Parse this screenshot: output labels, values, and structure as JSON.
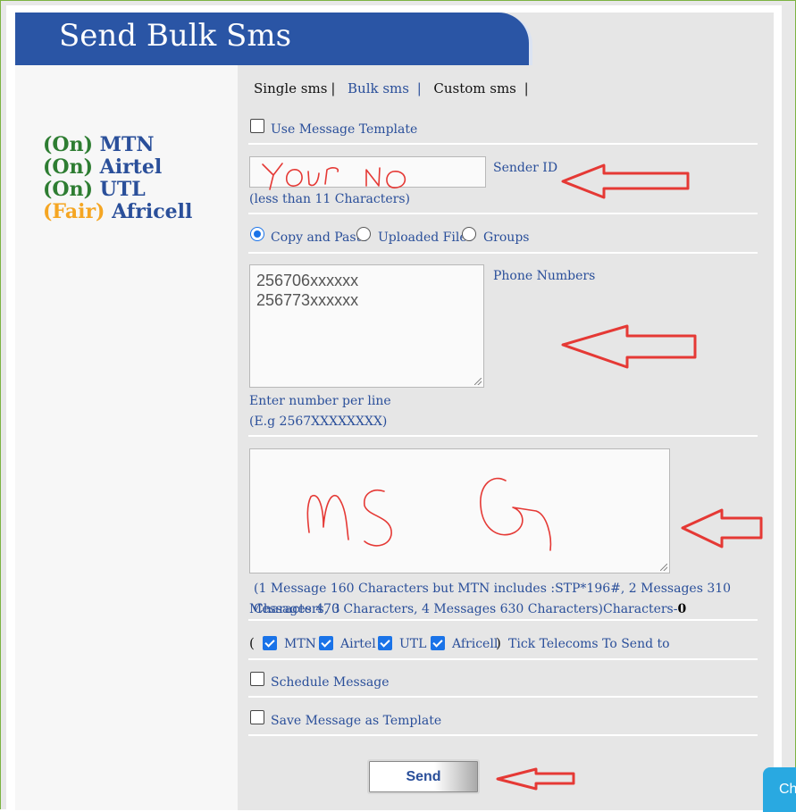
{
  "header": {
    "title": "Send Bulk Sms"
  },
  "status": [
    {
      "state": "(On)",
      "network": "MTN",
      "color": "#2e7d32"
    },
    {
      "state": "(On)",
      "network": "Airtel",
      "color": "#2e7d32"
    },
    {
      "state": "(On)",
      "network": "UTL",
      "color": "#2e7d32"
    },
    {
      "state": "(Fair)",
      "network": "Africell",
      "color": "#f5a623"
    }
  ],
  "tabs": {
    "single": "Single sms",
    "sep1": "|",
    "bulk": "Bulk sms",
    "sep2": "|",
    "custom": "Custom sms",
    "sep3": "|"
  },
  "form": {
    "use_template_label": "Use Message Template",
    "sender_id_label": "Sender ID",
    "sender_id_hint": "(less than 11 Characters)",
    "source_copy_paste": "Copy and Paste",
    "source_uploaded": "Uploaded Files",
    "source_groups": "Groups",
    "phone_numbers_label": "Phone Numbers",
    "phone_numbers_value_line1": "256706xxxxxx",
    "phone_numbers_value_line2": "256773xxxxxx",
    "enter_number_hint": "Enter number per line",
    "example_hint": "(E.g 2567XXXXXXXX)",
    "message_info": "(1 Message 160 Characters but MTN includes :STP*196#, 2 Messages 310 Characters, 3",
    "message_info_2": "Messages 470 Characters, 4 Messages 630 Characters)Characters-",
    "char_count": "0",
    "telecom_open": "(",
    "telecom_close": ")",
    "telecoms": [
      "MTN",
      "Airtel",
      "UTL",
      "Africell"
    ],
    "telecom_hint": "Tick Telecoms To Send to",
    "schedule_label": "Schedule Message",
    "save_template_label": "Save Message as Template",
    "send_label": "Send"
  },
  "annotations": {
    "sender_handwriting": "YOUR NO",
    "message_handwriting": "MSG"
  },
  "chat_widget": {
    "label": "Ch"
  },
  "colors": {
    "brand_blue": "#2a55a5",
    "link_blue": "#2a4f9a",
    "on_green": "#2e7d32",
    "fair_orange": "#f5a623",
    "annotation_red": "#e53935",
    "checkbox_blue": "#1a73e8"
  }
}
